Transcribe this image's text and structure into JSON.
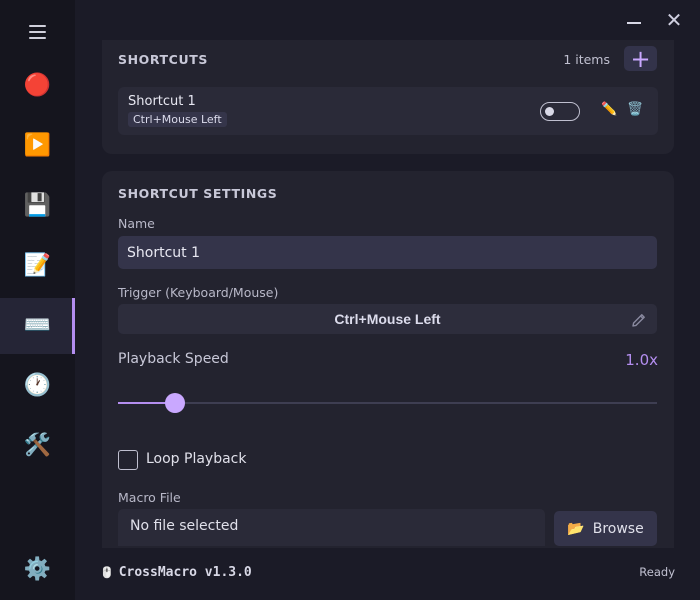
{
  "window": {
    "minimize_icon": "minimize-icon",
    "close_glyph": "✕"
  },
  "sidebar": {
    "items": [
      {
        "id": "menu",
        "icon": "hamburger-menu-icon",
        "glyph": ""
      },
      {
        "id": "record",
        "icon": "red-circle-icon",
        "glyph": "🔴"
      },
      {
        "id": "play",
        "icon": "play-button-icon",
        "glyph": "▶️"
      },
      {
        "id": "save",
        "icon": "floppy-disk-icon",
        "glyph": "💾"
      },
      {
        "id": "editor",
        "icon": "memo-icon",
        "glyph": "📝"
      },
      {
        "id": "shortcuts",
        "icon": "keyboard-icon",
        "glyph": "⌨️",
        "active": true
      },
      {
        "id": "scheduler",
        "icon": "clock-icon",
        "glyph": "🕐"
      },
      {
        "id": "tools",
        "icon": "tools-icon",
        "glyph": "🛠️"
      },
      {
        "id": "settings",
        "icon": "gear-icon",
        "glyph": "⚙️"
      }
    ]
  },
  "shortcuts": {
    "title": "SHORTCUTS",
    "count_label": "1 items",
    "add_glyph": "+",
    "list": [
      {
        "name": "Shortcut 1",
        "trigger": "Ctrl+Mouse Left",
        "enabled": false,
        "edit_glyph": "✏️",
        "delete_glyph": "🗑️"
      }
    ]
  },
  "settings": {
    "title": "SHORTCUT SETTINGS",
    "name_label": "Name",
    "name_value": "Shortcut 1",
    "trigger_label": "Trigger (Keyboard/Mouse)",
    "trigger_value": "Ctrl+Mouse Left",
    "speed_label": "Playback Speed",
    "speed_value": "1.0x",
    "speed_slider_fraction": 0.106,
    "loop_label": "Loop Playback",
    "loop_checked": false,
    "macro_file_label": "Macro File",
    "macro_file_value": "No file selected",
    "browse_glyph": "📂",
    "browse_label": "Browse"
  },
  "footer": {
    "brand_glyph": "🖱️",
    "app_name": "CrossMacro v1.3.0",
    "status": "Ready"
  },
  "colors": {
    "accent": "#b48ef0",
    "background": "#1b1b27",
    "sidebar": "#15151e",
    "panel": "#23232f"
  }
}
